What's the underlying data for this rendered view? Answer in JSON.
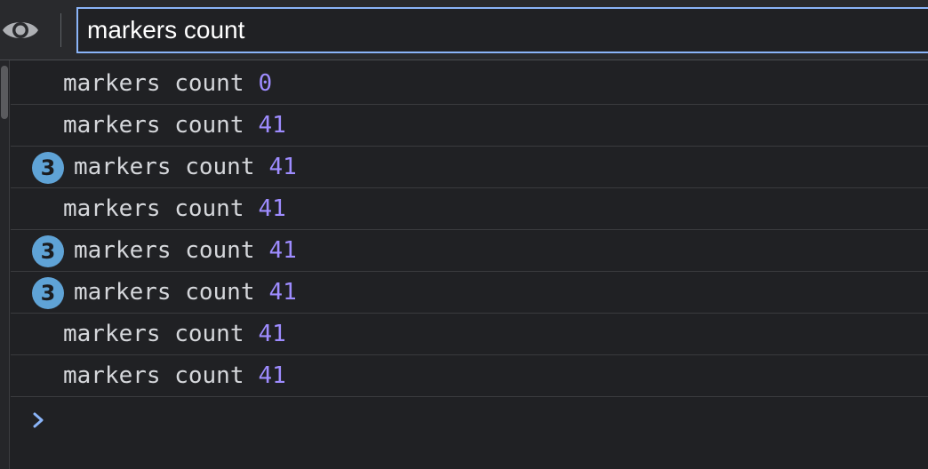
{
  "toolbar": {
    "eye_icon": "eye-icon",
    "filter": {
      "value": "markers count",
      "placeholder": "Filter"
    }
  },
  "console": {
    "colors": {
      "number": "#9e8cff",
      "badge": "#5fa3d6",
      "prompt": "#8ab4f8"
    },
    "rows": [
      {
        "message": "markers count",
        "value": "0",
        "repeat": null
      },
      {
        "message": "markers count",
        "value": "41",
        "repeat": null
      },
      {
        "message": "markers count",
        "value": "41",
        "repeat": "3"
      },
      {
        "message": "markers count",
        "value": "41",
        "repeat": null
      },
      {
        "message": "markers count",
        "value": "41",
        "repeat": "3"
      },
      {
        "message": "markers count",
        "value": "41",
        "repeat": "3"
      },
      {
        "message": "markers count",
        "value": "41",
        "repeat": null
      },
      {
        "message": "markers count",
        "value": "41",
        "repeat": null
      }
    ],
    "prompt_icon": "chevron-right-icon"
  }
}
